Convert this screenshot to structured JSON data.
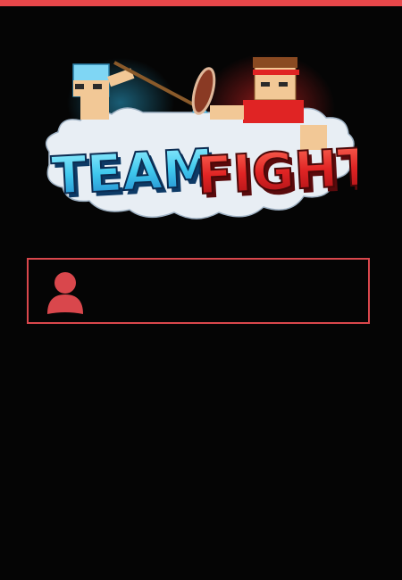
{
  "theme": {
    "accent": "#e8474a",
    "background": "#050505",
    "logo_blue": "#3fc8ee",
    "logo_red": "#e02424"
  },
  "logo": {
    "word_left": "TEAM",
    "word_right": "FIGHT",
    "icon": "team-fight-logo"
  },
  "login": {
    "icon": "user-icon",
    "value": "",
    "placeholder": ""
  }
}
